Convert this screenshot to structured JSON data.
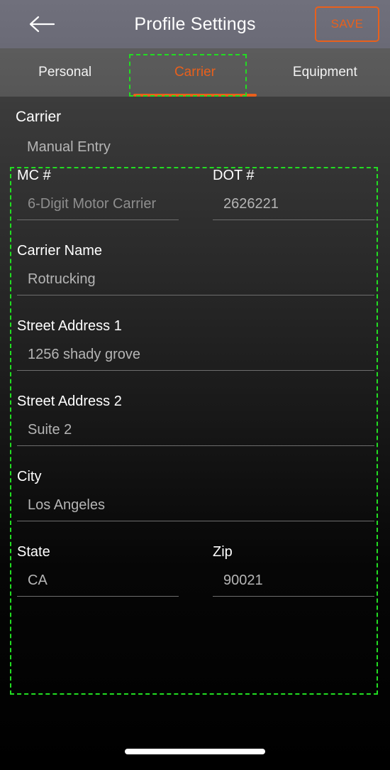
{
  "header": {
    "back_icon": "arrow-left-icon",
    "title": "Profile Settings",
    "save_label": "SAVE",
    "accent_color": "#e8601c"
  },
  "tabs": [
    {
      "label": "Personal",
      "active": false
    },
    {
      "label": "Carrier",
      "active": true
    },
    {
      "label": "Equipment",
      "active": false
    }
  ],
  "section": {
    "title": "Carrier",
    "subtitle": "Manual Entry"
  },
  "fields": {
    "mc": {
      "label": "MC #",
      "value": "",
      "placeholder": "6-Digit Motor Carrier"
    },
    "dot": {
      "label": "DOT #",
      "value": "2626221",
      "placeholder": ""
    },
    "carrier_name": {
      "label": "Carrier Name",
      "value": "Rotrucking",
      "placeholder": ""
    },
    "street1": {
      "label": "Street Address 1",
      "value": "1256 shady grove",
      "placeholder": ""
    },
    "street2": {
      "label": "Street Address 2",
      "value": "Suite 2",
      "placeholder": ""
    },
    "city": {
      "label": "City",
      "value": "Los Angeles",
      "placeholder": ""
    },
    "state": {
      "label": "State",
      "value": "CA",
      "placeholder": ""
    },
    "zip": {
      "label": "Zip",
      "value": "90021",
      "placeholder": ""
    }
  },
  "annotations": {
    "highlight_color": "#22dd22",
    "targets": [
      "carrier-tab",
      "carrier-form"
    ]
  }
}
